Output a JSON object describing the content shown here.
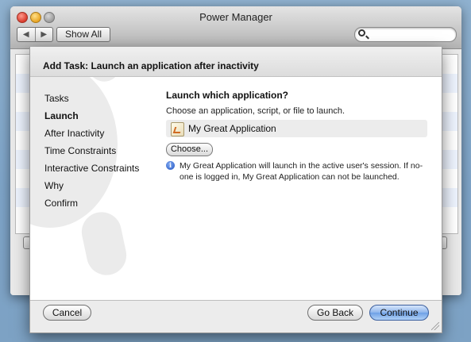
{
  "window": {
    "title": "Power Manager",
    "nav_back": "◀",
    "nav_forward": "▶",
    "show_all_label": "Show All",
    "search_placeholder": ""
  },
  "sheet": {
    "title": "Add Task: Launch an application after inactivity",
    "steps": [
      {
        "label": "Tasks"
      },
      {
        "label": "Launch",
        "current": true
      },
      {
        "label": "After Inactivity"
      },
      {
        "label": "Time Constraints"
      },
      {
        "label": "Interactive Constraints"
      },
      {
        "label": "Why"
      },
      {
        "label": "Confirm"
      }
    ],
    "pane": {
      "heading": "Launch which application?",
      "description": "Choose an application, script, or file to launch.",
      "selected_app": "My Great Application",
      "choose_button": "Choose...",
      "info_icon": "i",
      "info_text": "My Great Application will launch in the active user's session. If no-one is logged in, My Great Application can not be launched."
    },
    "buttons": {
      "cancel": "Cancel",
      "back": "Go Back",
      "continue": "Continue"
    }
  },
  "colors": {
    "default_button_blue": "#8db5ec",
    "list_alt_row": "#edf3fe"
  }
}
